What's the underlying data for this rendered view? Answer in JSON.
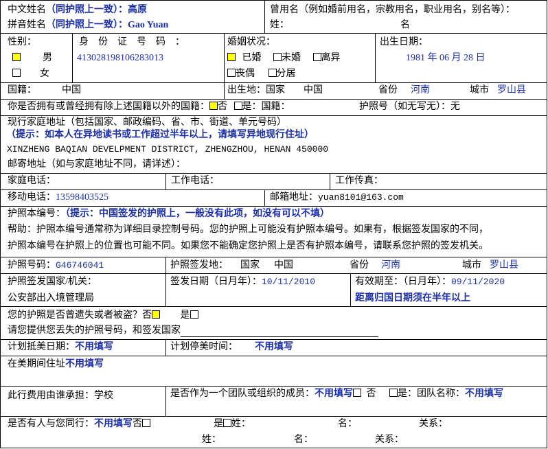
{
  "r1": {
    "cn_name_label": "中文姓名",
    "cn_name_hint": "（同护照上一致）：",
    "cn_name_value": "高原",
    "py_name_label": "拼音姓名",
    "py_name_hint": "（同护照上一致）：",
    "py_name_value": "Gao Yuan",
    "used_name_label": "曾用名（例如婚前用名，宗教用名，职业用名，别名等）：",
    "surname_label": "姓：",
    "given_label": "名"
  },
  "r2": {
    "gender_label": "性别：",
    "male": "男",
    "female": "女",
    "id_label": "身　份　证　号　码　：",
    "id_value": "413028198106283013",
    "marital_label": "婚姻状况：",
    "married": "已婚",
    "unmarried": "未婚",
    "divorced": "离异",
    "widowed": "丧偶",
    "separated": "分居",
    "dob_label": "出生日期：",
    "dob_value": "1981 年 06 月 28 日"
  },
  "r3": {
    "nationality_label": "国籍：",
    "nationality_value": "中国",
    "birthplace_label": "出生地：国家",
    "birth_country": "中国",
    "province_label": "省份",
    "province_value": "河南",
    "city_label": "城市",
    "city_value": "罗山县"
  },
  "r4": {
    "other_nat_label": "你是否拥有或曾经拥有除上述国籍以外的国籍：",
    "no": "否",
    "yes_country": "是：国籍：",
    "passport_no_label": "护照号（如无写无）：无"
  },
  "r5": {
    "address_label": "现行家庭地址（包括国家、邮政编码、省、市、街道、单元号码）",
    "address_hint": "（提示：如本人在异地读书或工作超过半年以上，请填写异地现行住址）",
    "address_value": "XINZHENG BAQIAN DEVELPMENT DISTRICT, ZHENGZHOU, HENAN   450000",
    "mailing_label": "邮寄地址（如与家庭地址不同，请详述）："
  },
  "r6": {
    "home_phone": "家庭电话：",
    "work_phone": "工作电话：",
    "work_fax": "工作传真："
  },
  "r7": {
    "mobile_label": "移动电话：",
    "mobile_value": "13598403525",
    "email_label": "邮箱地址：",
    "email_value": "yuan8101@163.com"
  },
  "r8": {
    "book_label": "护照本编号：",
    "book_hint": "（提示：中国签发的护照上，一般没有此项，如没有可以不填）",
    "help_line1": "帮助：护照本编号通常称为详细目录控制号码。您的护照上可能没有护照本编号。如果有，根据签发国家的不同，",
    "help_line2": "护照本编号在护照上的位置也可能不同。如果您不能确定您护照上是否有护照本编号，请联系您护照的签发机关。"
  },
  "r9": {
    "pp_no_label": "护照号码：",
    "pp_no_value": "G46746041",
    "issue_place_label": "护照签发地：",
    "country_label": "国家",
    "country_value": "中国",
    "province_label": "省份",
    "province_value": "河南",
    "city_label": "城市",
    "city_value": "罗山县"
  },
  "r10": {
    "authority_label": "护照签发国家/机关：",
    "authority_value": "公安部出入境管理局",
    "issue_date_label": "签发日期（日月年）：",
    "issue_date_value": "10/11/2010",
    "expiry_label": "有效期至：（日月年）：",
    "expiry_value": "09/11/2020",
    "expiry_note": "距离归国日期须在半年以上"
  },
  "r11": {
    "lost_label": "您的护照是否曾遗失或者被盗？否",
    "yes": "是",
    "lost_detail": "请您提供您丢失的护照号码，和签发国家"
  },
  "r12": {
    "arrival_label": "计划抵美日期：",
    "arrival_value": "不用填写",
    "stay_label": "计划停美时间：",
    "stay_value": "不用填写"
  },
  "r13": {
    "us_address_label": "在美期间住址",
    "us_address_value": "不用填写"
  },
  "r14": {
    "payer_label": "此行费用由谁承担：学校",
    "group_label": "是否作为一个团队或组织的成员：",
    "group_value": "不用填写",
    "no": "否",
    "yes_group": "是：团队名称：",
    "group_name_value": "不用填写"
  },
  "r15": {
    "companion_label": "是否有人与您同行：",
    "companion_value": "不用填写",
    "no": "否",
    "yes_surname": "是",
    "surname": "姓：",
    "given": "名：",
    "relation": "关系：",
    "surname2": "姓：",
    "given2": "名：",
    "relation2": "关系："
  },
  "colors": {
    "blue_text": "#1b2fa8",
    "highlight": "#ffff00"
  }
}
